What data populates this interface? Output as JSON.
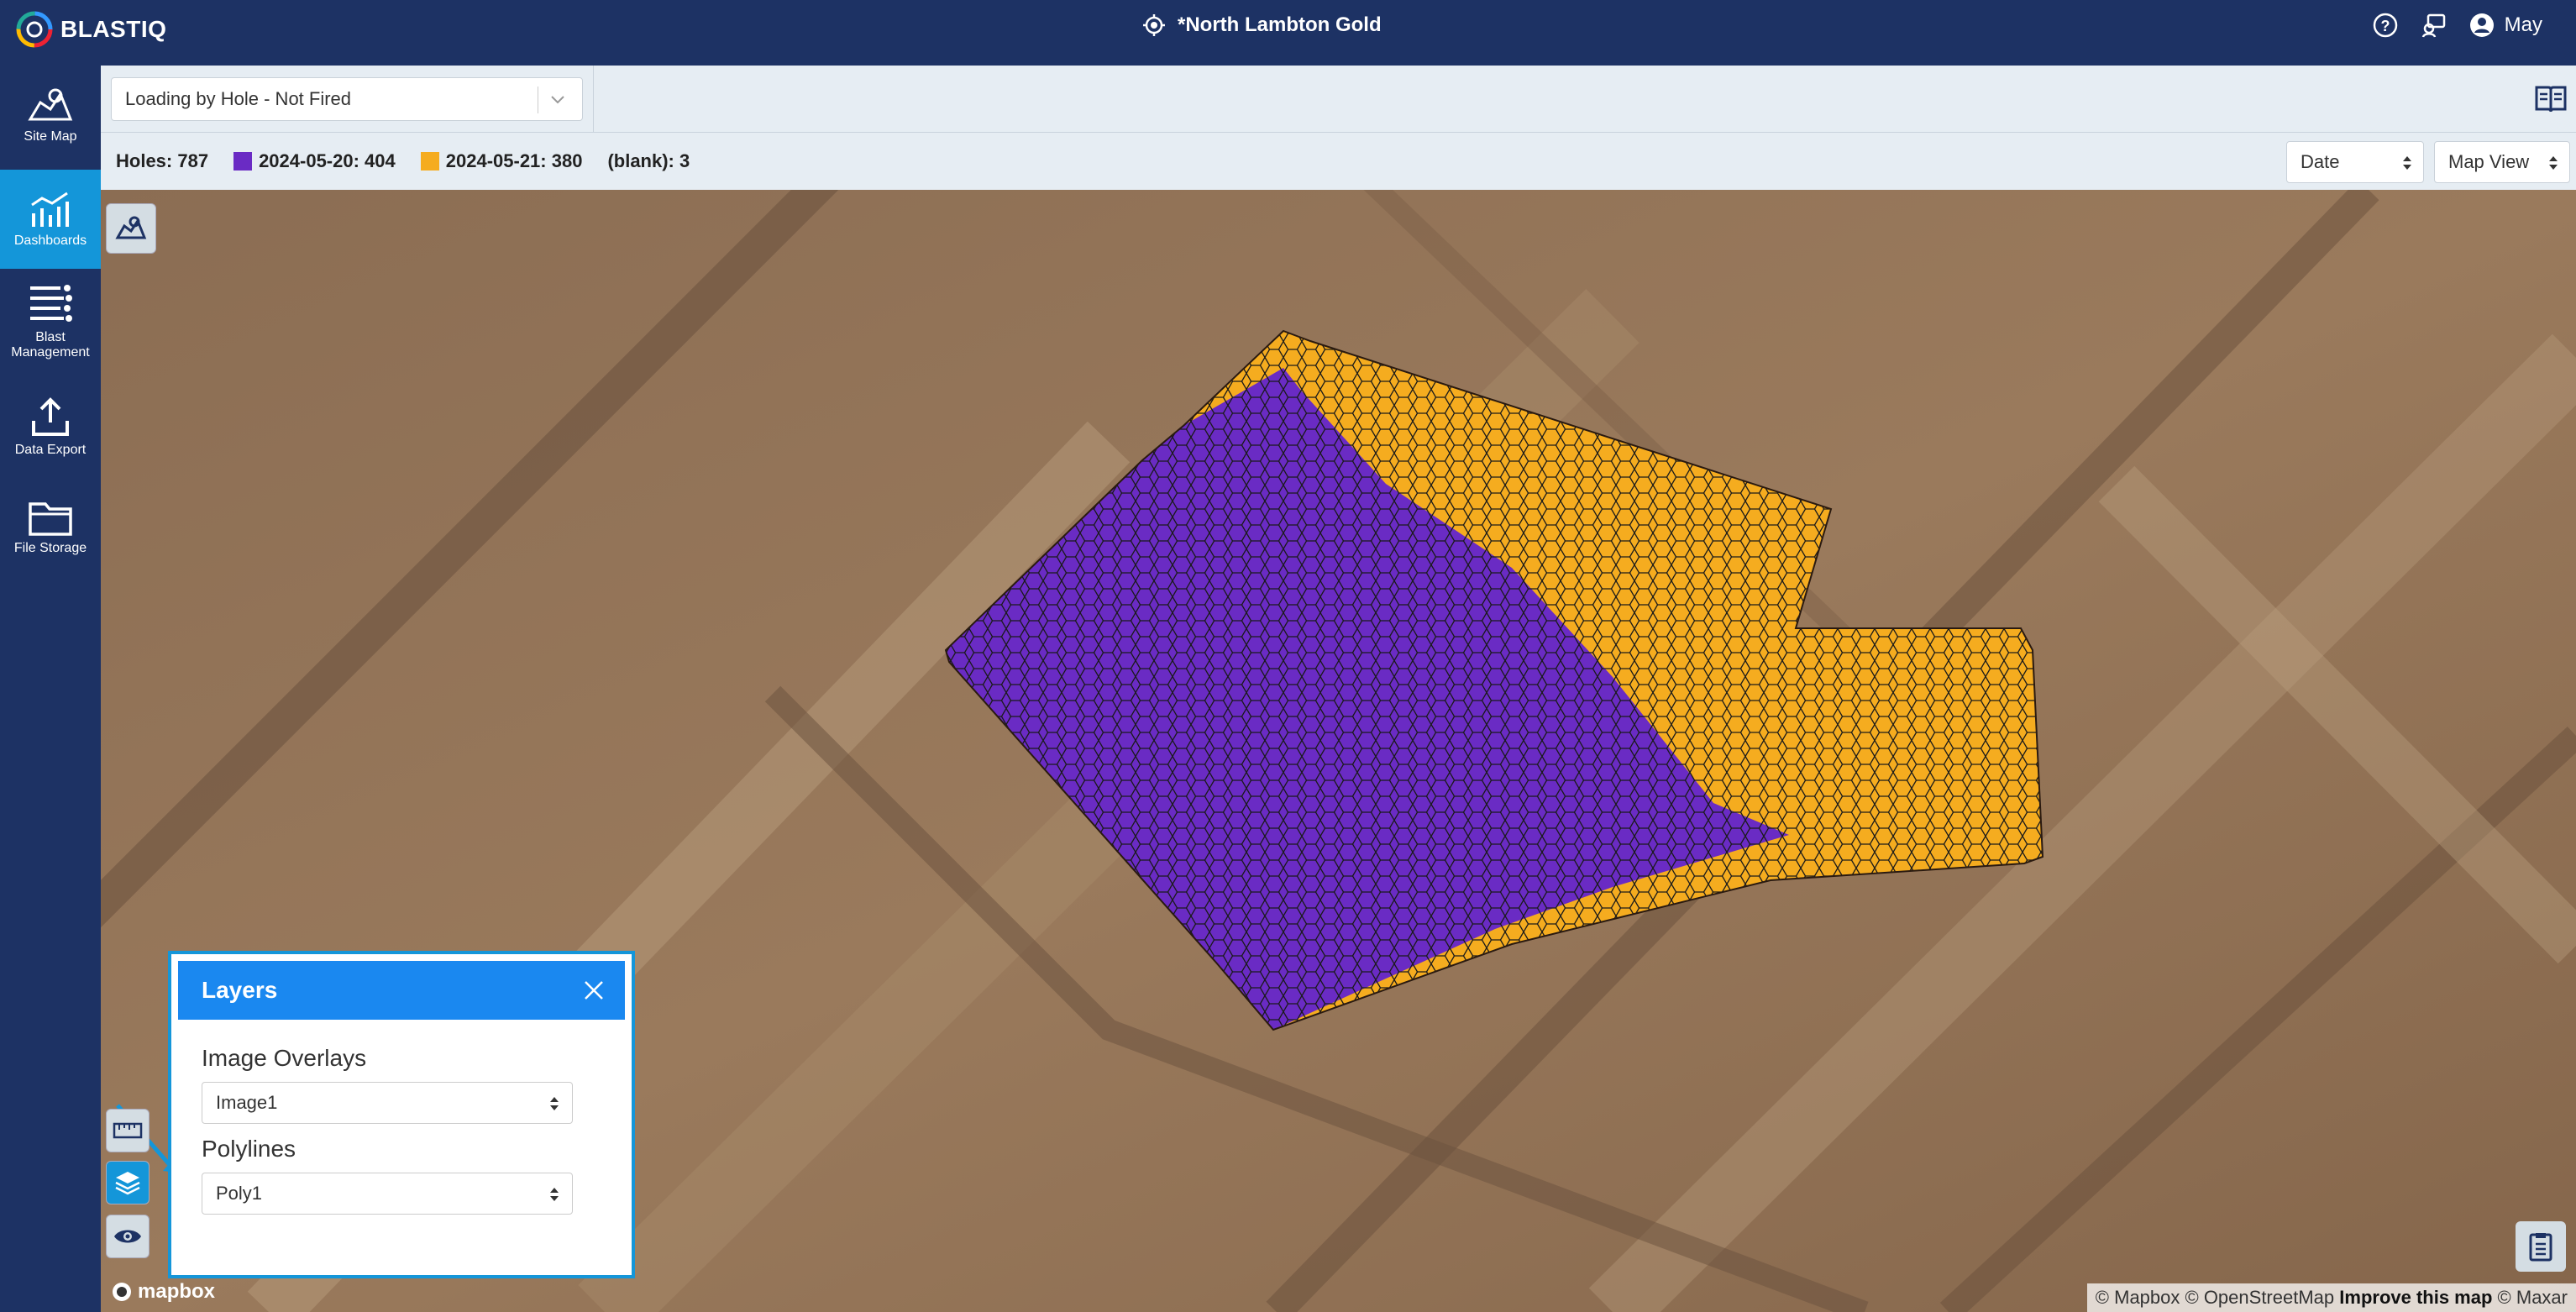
{
  "app": {
    "logo_text": "BLASTIQ",
    "site_title": "*North Lambton Gold",
    "user_name": "May"
  },
  "nav": [
    {
      "label": "Site Map"
    },
    {
      "label": "Dashboards"
    },
    {
      "label": "Blast Management"
    },
    {
      "label": "Data Export"
    },
    {
      "label": "File Storage"
    }
  ],
  "toolbar": {
    "view_select": "Loading by Hole - Not Fired"
  },
  "legend": {
    "holes": "Holes: 787",
    "series1": "2024-05-20: 404",
    "series2": "2024-05-21: 380",
    "blank": "(blank): 3",
    "color1": "#6a2bc4",
    "color2": "#f5ac1f",
    "date_select": "Date",
    "view_select": "Map View"
  },
  "layers": {
    "title": "Layers",
    "image_overlays_label": "Image Overlays",
    "image_overlays_value": "Image1",
    "polylines_label": "Polylines",
    "polylines_value": "Poly1"
  },
  "map": {
    "mapbox": "mapbox",
    "attrib_1": "© Mapbox © OpenStreetMap",
    "attrib_improve": "Improve this map",
    "attrib_2": "© Maxar"
  }
}
